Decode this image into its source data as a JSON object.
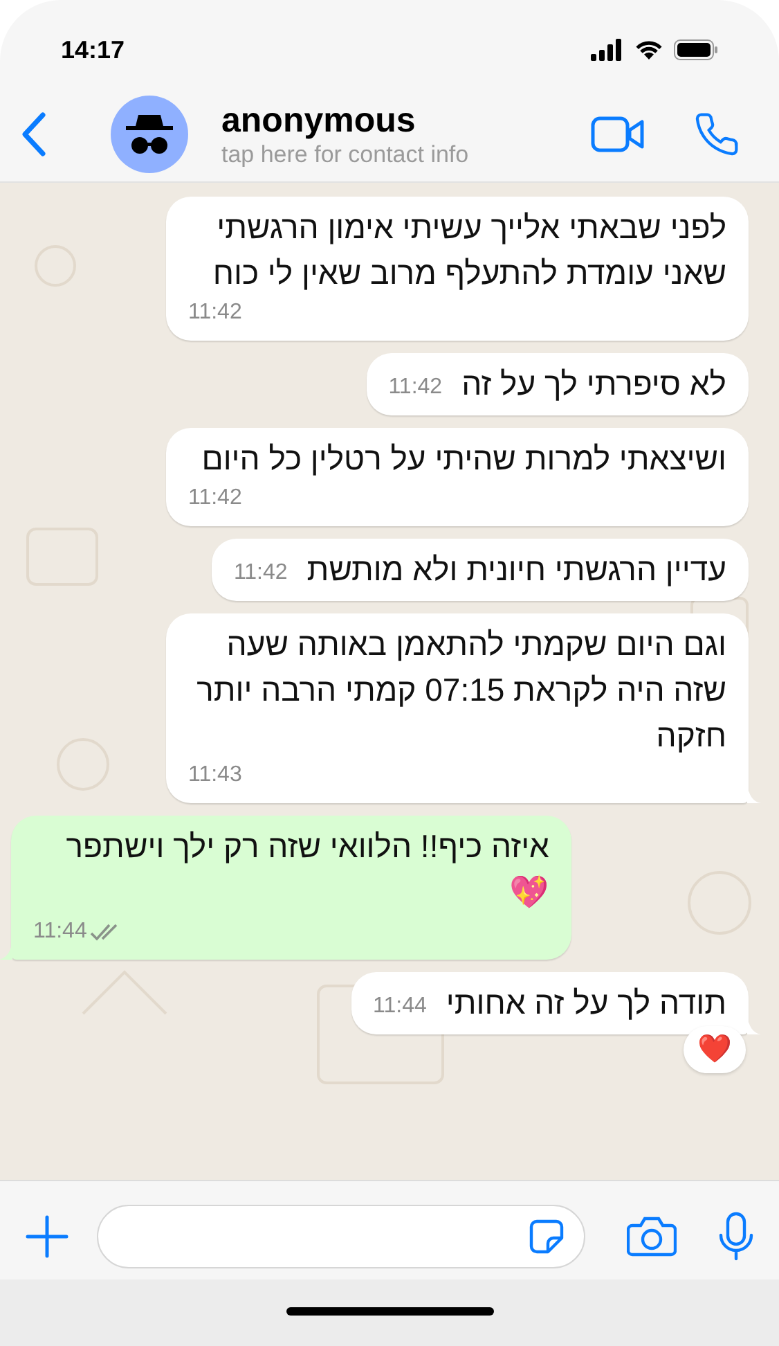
{
  "status_bar": {
    "time": "14:17"
  },
  "header": {
    "name": "anonymous",
    "subtitle": "tap here for contact info"
  },
  "messages": [
    {
      "kind": "received",
      "text": "לפני שבאתי אלייך עשיתי אימון הרגשתי שאני עומדת להתעלף מרוב שאין לי כוח",
      "time": "11:42",
      "tail": false
    },
    {
      "kind": "received",
      "text": "לא סיפרתי לך על זה",
      "time": "11:42",
      "tail": false
    },
    {
      "kind": "received",
      "text": "ושיצאתי למרות שהיתי על רטלין כל היום",
      "time": "11:42",
      "tail": false
    },
    {
      "kind": "received",
      "text": "עדיין הרגשתי חיונית ולא מותשת",
      "time": "11:42",
      "tail": false
    },
    {
      "kind": "received",
      "text": "וגם היום שקמתי להתאמן באותה שעה שזה היה לקראת 07:15 קמתי הרבה יותר חזקה",
      "time": "11:43",
      "tail": true
    },
    {
      "kind": "sent",
      "text": "איזה כיף!! הלוואי שזה רק ילך וישתפר\n💖",
      "time": "11:44",
      "tail": true,
      "read": false
    },
    {
      "kind": "received",
      "text": "תודה לך על זה אחותי",
      "time": "11:44",
      "tail": true,
      "reaction": "❤️"
    }
  ]
}
